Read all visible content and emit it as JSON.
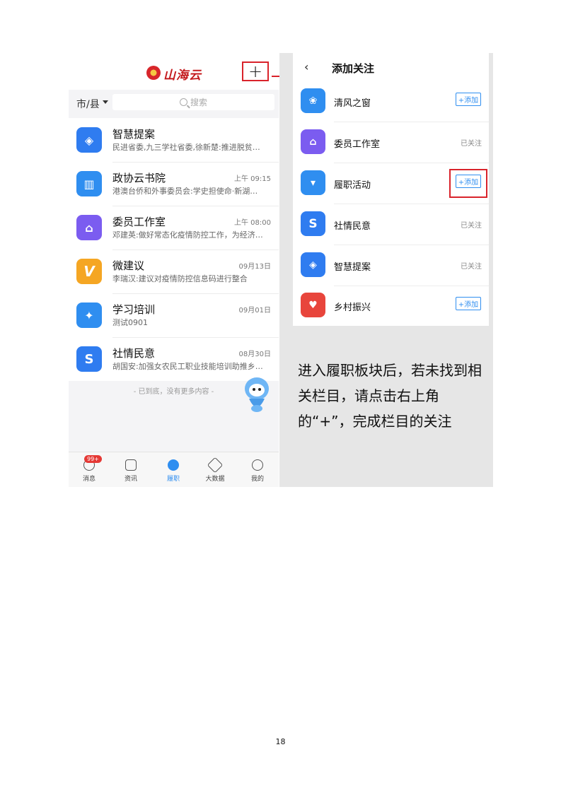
{
  "left_screen": {
    "logo_text": "山海云",
    "region": "市/县",
    "search_placeholder": "搜索",
    "items": [
      {
        "title": "智慧提案",
        "time": "",
        "subtitle": "民进省委,九三学社省委,徐新楚:推进脱贫…",
        "icon": "bulb-icon",
        "color": "#2f7cf0"
      },
      {
        "title": "政协云书院",
        "time": "上午 09:15",
        "subtitle": "港澳台侨和外事委员会:学史担使命·新湖…",
        "icon": "book-icon",
        "color": "#2f8ef0"
      },
      {
        "title": "委员工作室",
        "time": "上午 08:00",
        "subtitle": "邓建英:做好常态化疫情防控工作，为经济…",
        "icon": "house-icon",
        "color": "#7b5cf0"
      },
      {
        "title": "微建议",
        "time": "09月13日",
        "subtitle": "李瑞汉:建议对疫情防控信息码进行整合",
        "icon": "v-icon",
        "color": "#f5a623"
      },
      {
        "title": "学习培训",
        "time": "09月01日",
        "subtitle": "测试0901",
        "icon": "lightbulb-icon",
        "color": "#2f8ef0"
      },
      {
        "title": "社情民意",
        "time": "08月30日",
        "subtitle": "胡国安:加强女农民工职业技能培训助推乡…",
        "icon": "s-icon",
        "color": "#2f7cf0"
      }
    ],
    "end_text": "- 已到底，没有更多内容 -",
    "tabs": [
      {
        "label": "消息",
        "icon": "message-icon"
      },
      {
        "label": "资讯",
        "icon": "news-icon"
      },
      {
        "label": "履职",
        "icon": "duty-icon"
      },
      {
        "label": "大数据",
        "icon": "chart-icon"
      },
      {
        "label": "我的",
        "icon": "profile-icon"
      }
    ],
    "badge": "99+",
    "plus": "+"
  },
  "right_screen": {
    "back": "‹",
    "title": "添加关注",
    "items": [
      {
        "name": "清风之窗",
        "status": "+添加",
        "icon": "lotus-icon",
        "color": "#2f8ef0"
      },
      {
        "name": "委员工作室",
        "status": "已关注",
        "icon": "house-icon",
        "color": "#7b5cf0"
      },
      {
        "name": "履职活动",
        "status": "+添加",
        "icon": "tie-icon",
        "color": "#2f8ef0"
      },
      {
        "name": "社情民意",
        "status": "已关注",
        "icon": "s-icon",
        "color": "#2f7cf0"
      },
      {
        "name": "智慧提案",
        "status": "已关注",
        "icon": "bulb-icon",
        "color": "#2f7cf0"
      },
      {
        "name": "乡村振兴",
        "status": "+添加",
        "icon": "heart-hand-icon",
        "color": "#e8453c"
      }
    ]
  },
  "instruction": "进入履职板块后，若未找到相关栏目，请点击右上角的“+”，完成栏目的关注",
  "page_number": "18"
}
